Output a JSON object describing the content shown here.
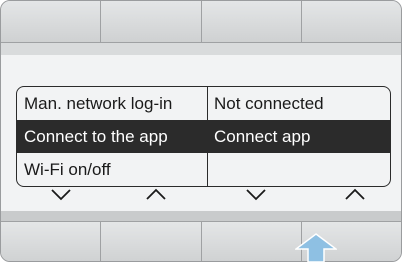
{
  "menu": {
    "rows": [
      {
        "setting": "Man. network log-in",
        "value": "Not connected"
      },
      {
        "setting": "Connect to the app",
        "value": "Connect app"
      },
      {
        "setting": "Wi-Fi on/off",
        "value": ""
      }
    ]
  },
  "navigation": [
    "chevron-down-icon",
    "chevron-up-icon",
    "chevron-down-icon",
    "chevron-up-icon"
  ],
  "highlight": "arrow-up-icon",
  "colors": {
    "selected_row": "#2b2b2b",
    "screen": "#f2f3f4",
    "pointer": "#8ec0e3"
  }
}
